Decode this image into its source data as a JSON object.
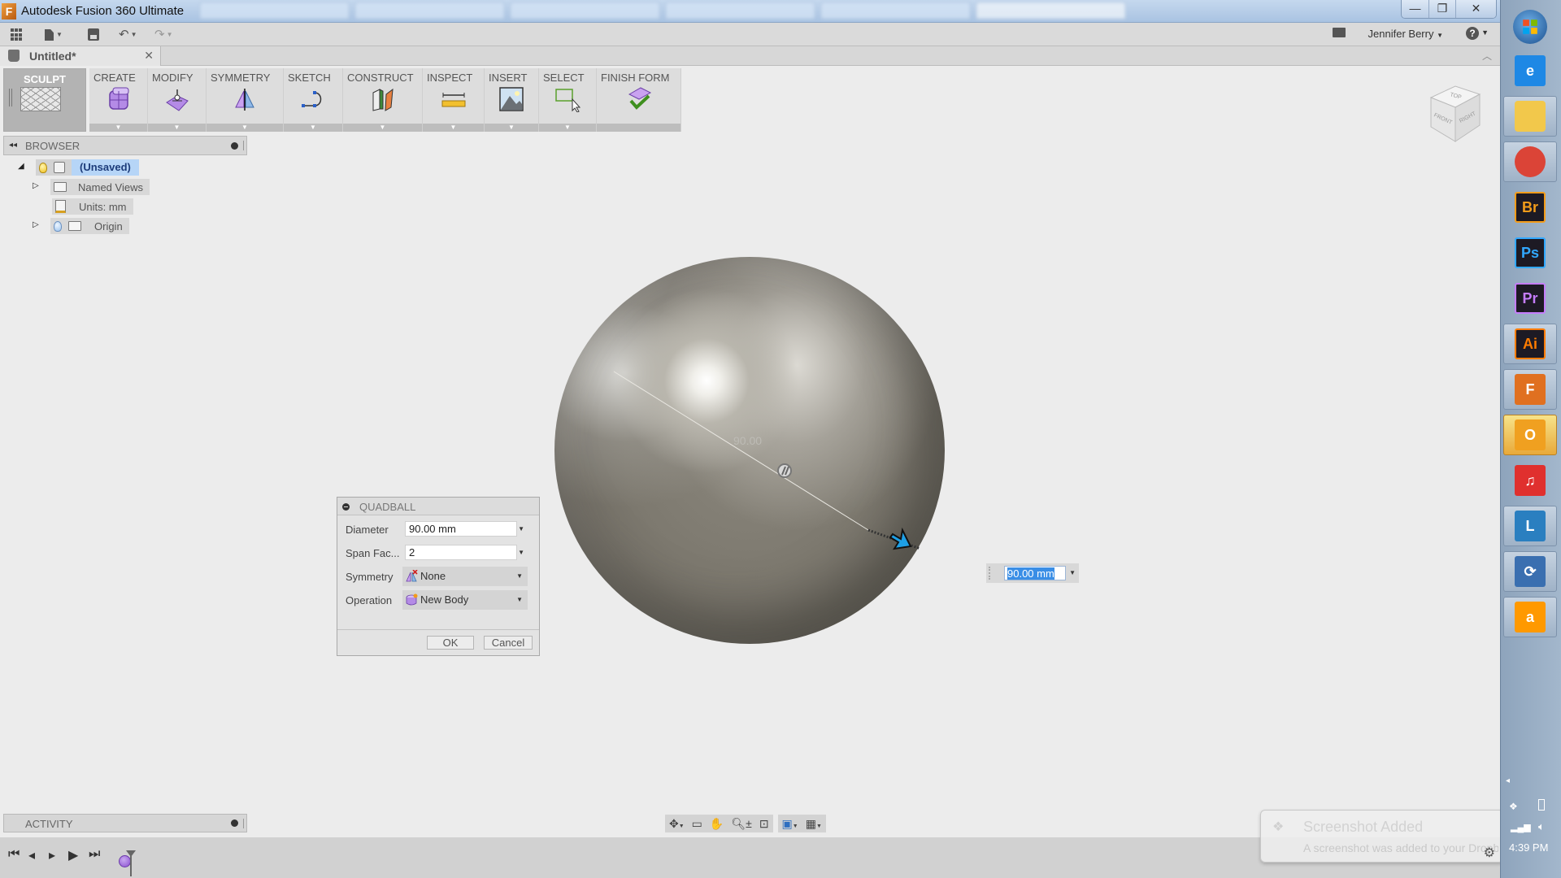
{
  "window": {
    "title": "Autodesk Fusion 360 Ultimate",
    "controls": {
      "minimize": "—",
      "restore": "❐",
      "close": "✕"
    }
  },
  "quick_access": {
    "icons": [
      "app-grid-icon",
      "file-icon",
      "save-icon",
      "undo-icon",
      "redo-icon"
    ],
    "user_name": "Jennifer Berry",
    "help_label": "?"
  },
  "document_tab": {
    "name": "Untitled*",
    "close": "✕"
  },
  "ribbon": {
    "workspace": "SCULPT",
    "groups": [
      {
        "label": "CREATE",
        "icon": "box-icon",
        "has_dropdown": true
      },
      {
        "label": "MODIFY",
        "icon": "edit-form-icon",
        "has_dropdown": true
      },
      {
        "label": "SYMMETRY",
        "icon": "symmetry-icon",
        "has_dropdown": true
      },
      {
        "label": "SKETCH",
        "icon": "sketch-curve-icon",
        "has_dropdown": true
      },
      {
        "label": "CONSTRUCT",
        "icon": "plane-icon",
        "has_dropdown": true
      },
      {
        "label": "INSPECT",
        "icon": "measure-icon",
        "has_dropdown": true
      },
      {
        "label": "INSERT",
        "icon": "image-icon",
        "has_dropdown": true
      },
      {
        "label": "SELECT",
        "icon": "select-window-icon",
        "has_dropdown": true
      },
      {
        "label": "FINISH FORM",
        "icon": "finish-form-icon",
        "has_dropdown": false
      }
    ]
  },
  "browser": {
    "title": "BROWSER",
    "tree": [
      {
        "label": "(Unsaved)",
        "level": 0,
        "expanded": true,
        "selected": true
      },
      {
        "label": "Named Views",
        "level": 1,
        "expanded": false
      },
      {
        "label": "Units: mm",
        "level": 1
      },
      {
        "label": "Origin",
        "level": 1,
        "expanded": false
      }
    ]
  },
  "viewcube": {
    "faces": [
      "TOP",
      "FRONT",
      "RIGHT"
    ]
  },
  "canvas": {
    "dimension_label": "90.00"
  },
  "quadball_dialog": {
    "title": "QUADBALL",
    "fields": [
      {
        "label": "Diameter",
        "value": "90.00 mm",
        "type": "input"
      },
      {
        "label": "Span Fac...",
        "value": "2",
        "type": "input"
      },
      {
        "label": "Symmetry",
        "value": "None",
        "type": "select"
      },
      {
        "label": "Operation",
        "value": "New Body",
        "type": "select"
      }
    ],
    "ok": "OK",
    "cancel": "Cancel"
  },
  "floating_input": {
    "value": "90.00 mm"
  },
  "activity": {
    "title": "ACTIVITY"
  },
  "timeline": {
    "controls": [
      "⏮",
      "◂",
      "▸",
      "▶",
      "⏭"
    ]
  },
  "notification": {
    "title": "Screenshot Added",
    "message": "A screenshot was added to your Dropbox."
  },
  "taskbar": {
    "apps": [
      {
        "name": "Internet Explorer",
        "glyph": "e",
        "color": "#1e88e5"
      },
      {
        "name": "Windows Explorer",
        "glyph": "",
        "color": "#f2c84b"
      },
      {
        "name": "Google Chrome",
        "glyph": "",
        "color": "#db4437"
      },
      {
        "name": "Adobe Bridge",
        "glyph": "Br",
        "color": "#f39c1a"
      },
      {
        "name": "Adobe Photoshop",
        "glyph": "Ps",
        "color": "#31a8ff"
      },
      {
        "name": "Adobe Premiere",
        "glyph": "Pr",
        "color": "#c57dfc"
      },
      {
        "name": "Adobe Illustrator",
        "glyph": "Ai",
        "color": "#ff7c00"
      },
      {
        "name": "Fusion 360",
        "glyph": "F",
        "color": "#e07020"
      },
      {
        "name": "Outlook",
        "glyph": "O",
        "color": "#f0a020"
      },
      {
        "name": "iTunes",
        "glyph": "♫",
        "color": "#e0302e"
      },
      {
        "name": "Lync",
        "glyph": "L",
        "color": "#2a7fc0"
      },
      {
        "name": "Windows Update",
        "glyph": "⟳",
        "color": "#3a6fb0"
      },
      {
        "name": "Amazon",
        "glyph": "a",
        "color": "#ff9900"
      }
    ],
    "clock": "4:39 PM"
  }
}
